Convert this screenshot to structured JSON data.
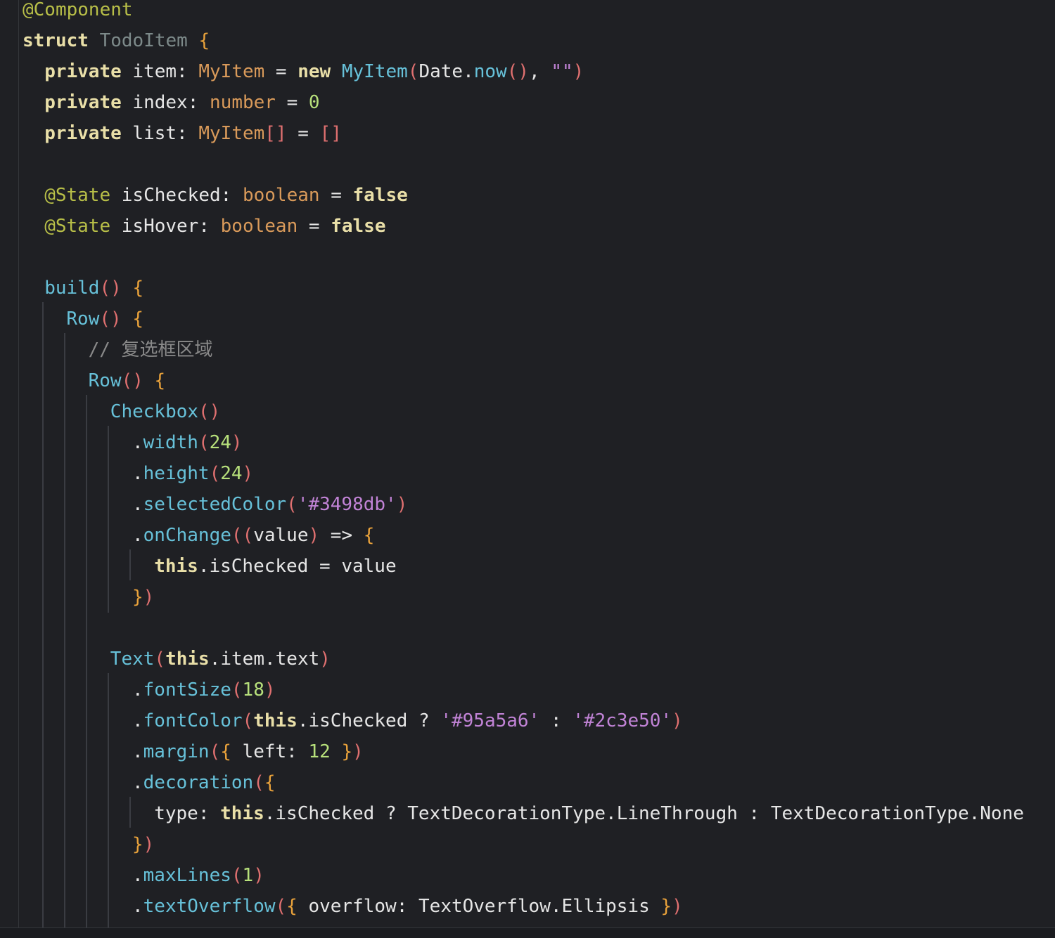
{
  "editor": {
    "lines": [
      [
        [
          "t-ann",
          "@Component"
        ]
      ],
      [
        [
          "t-kw",
          "struct"
        ],
        [
          "t-op",
          " "
        ],
        [
          "t-name",
          "TodoItem"
        ],
        [
          "t-op",
          " "
        ],
        [
          "t-brace",
          "{"
        ]
      ],
      [
        [
          "t-kw",
          "private"
        ],
        [
          "t-op",
          " "
        ],
        [
          "t-ident",
          "item"
        ],
        [
          "t-punc",
          ": "
        ],
        [
          "t-type",
          "MyItem"
        ],
        [
          "t-op",
          " = "
        ],
        [
          "t-kw",
          "new"
        ],
        [
          "t-op",
          " "
        ],
        [
          "t-fn",
          "MyItem"
        ],
        [
          "t-paren",
          "("
        ],
        [
          "t-ident",
          "Date"
        ],
        [
          "t-punc",
          "."
        ],
        [
          "t-fn",
          "now"
        ],
        [
          "t-paren",
          "()"
        ],
        [
          "t-punc",
          ", "
        ],
        [
          "t-str",
          "\"\""
        ],
        [
          "t-paren",
          ")"
        ]
      ],
      [
        [
          "t-kw",
          "private"
        ],
        [
          "t-op",
          " "
        ],
        [
          "t-ident",
          "index"
        ],
        [
          "t-punc",
          ": "
        ],
        [
          "t-type",
          "number"
        ],
        [
          "t-op",
          " = "
        ],
        [
          "t-num",
          "0"
        ]
      ],
      [
        [
          "t-kw",
          "private"
        ],
        [
          "t-op",
          " "
        ],
        [
          "t-ident",
          "list"
        ],
        [
          "t-punc",
          ": "
        ],
        [
          "t-type",
          "MyItem"
        ],
        [
          "t-paren",
          "[]"
        ],
        [
          "t-op",
          " = "
        ],
        [
          "t-paren",
          "[]"
        ]
      ],
      [],
      [
        [
          "t-ann",
          "@State"
        ],
        [
          "t-op",
          " "
        ],
        [
          "t-ident",
          "isChecked"
        ],
        [
          "t-punc",
          ": "
        ],
        [
          "t-type",
          "boolean"
        ],
        [
          "t-op",
          " = "
        ],
        [
          "t-kw",
          "false"
        ]
      ],
      [
        [
          "t-ann",
          "@State"
        ],
        [
          "t-op",
          " "
        ],
        [
          "t-ident",
          "isHover"
        ],
        [
          "t-punc",
          ": "
        ],
        [
          "t-type",
          "boolean"
        ],
        [
          "t-op",
          " = "
        ],
        [
          "t-kw",
          "false"
        ]
      ],
      [],
      [
        [
          "t-fn",
          "build"
        ],
        [
          "t-paren",
          "()"
        ],
        [
          "t-op",
          " "
        ],
        [
          "t-brace",
          "{"
        ]
      ],
      [
        [
          "t-fn",
          "Row"
        ],
        [
          "t-paren",
          "()"
        ],
        [
          "t-op",
          " "
        ],
        [
          "t-brace",
          "{"
        ]
      ],
      [
        [
          "t-cmt",
          "// 复选框区域"
        ]
      ],
      [
        [
          "t-fn",
          "Row"
        ],
        [
          "t-paren",
          "()"
        ],
        [
          "t-op",
          " "
        ],
        [
          "t-brace",
          "{"
        ]
      ],
      [
        [
          "t-fn",
          "Checkbox"
        ],
        [
          "t-paren",
          "()"
        ]
      ],
      [
        [
          "t-punc",
          "."
        ],
        [
          "t-fn",
          "width"
        ],
        [
          "t-paren",
          "("
        ],
        [
          "t-num",
          "24"
        ],
        [
          "t-paren",
          ")"
        ]
      ],
      [
        [
          "t-punc",
          "."
        ],
        [
          "t-fn",
          "height"
        ],
        [
          "t-paren",
          "("
        ],
        [
          "t-num",
          "24"
        ],
        [
          "t-paren",
          ")"
        ]
      ],
      [
        [
          "t-punc",
          "."
        ],
        [
          "t-fn",
          "selectedColor"
        ],
        [
          "t-paren",
          "("
        ],
        [
          "t-str",
          "'#3498db'"
        ],
        [
          "t-paren",
          ")"
        ]
      ],
      [
        [
          "t-punc",
          "."
        ],
        [
          "t-fn",
          "onChange"
        ],
        [
          "t-paren",
          "(("
        ],
        [
          "t-ident",
          "value"
        ],
        [
          "t-paren",
          ")"
        ],
        [
          "t-op",
          " => "
        ],
        [
          "t-brace",
          "{"
        ]
      ],
      [
        [
          "t-kw",
          "this"
        ],
        [
          "t-punc",
          "."
        ],
        [
          "t-ident",
          "isChecked"
        ],
        [
          "t-op",
          " = "
        ],
        [
          "t-ident",
          "value"
        ]
      ],
      [
        [
          "t-brace",
          "}"
        ],
        [
          "t-paren",
          ")"
        ]
      ],
      [],
      [
        [
          "t-fn",
          "Text"
        ],
        [
          "t-paren",
          "("
        ],
        [
          "t-kw",
          "this"
        ],
        [
          "t-punc",
          "."
        ],
        [
          "t-ident",
          "item"
        ],
        [
          "t-punc",
          "."
        ],
        [
          "t-ident",
          "text"
        ],
        [
          "t-paren",
          ")"
        ]
      ],
      [
        [
          "t-punc",
          "."
        ],
        [
          "t-fn",
          "fontSize"
        ],
        [
          "t-paren",
          "("
        ],
        [
          "t-num",
          "18"
        ],
        [
          "t-paren",
          ")"
        ]
      ],
      [
        [
          "t-punc",
          "."
        ],
        [
          "t-fn",
          "fontColor"
        ],
        [
          "t-paren",
          "("
        ],
        [
          "t-kw",
          "this"
        ],
        [
          "t-punc",
          "."
        ],
        [
          "t-ident",
          "isChecked"
        ],
        [
          "t-op",
          " ? "
        ],
        [
          "t-str",
          "'#95a5a6'"
        ],
        [
          "t-op",
          " : "
        ],
        [
          "t-str",
          "'#2c3e50'"
        ],
        [
          "t-paren",
          ")"
        ]
      ],
      [
        [
          "t-punc",
          "."
        ],
        [
          "t-fn",
          "margin"
        ],
        [
          "t-paren",
          "("
        ],
        [
          "t-brace",
          "{"
        ],
        [
          "t-op",
          " "
        ],
        [
          "t-ident",
          "left"
        ],
        [
          "t-punc",
          ": "
        ],
        [
          "t-num",
          "12"
        ],
        [
          "t-op",
          " "
        ],
        [
          "t-brace",
          "}"
        ],
        [
          "t-paren",
          ")"
        ]
      ],
      [
        [
          "t-punc",
          "."
        ],
        [
          "t-fn",
          "decoration"
        ],
        [
          "t-paren",
          "("
        ],
        [
          "t-brace",
          "{"
        ]
      ],
      [
        [
          "t-ident",
          "type"
        ],
        [
          "t-punc",
          ": "
        ],
        [
          "t-kw",
          "this"
        ],
        [
          "t-punc",
          "."
        ],
        [
          "t-ident",
          "isChecked"
        ],
        [
          "t-op",
          " ? "
        ],
        [
          "t-ident",
          "TextDecorationType"
        ],
        [
          "t-punc",
          "."
        ],
        [
          "t-ident",
          "LineThrough"
        ],
        [
          "t-op",
          " : "
        ],
        [
          "t-ident",
          "TextDecorationType"
        ],
        [
          "t-punc",
          "."
        ],
        [
          "t-ident",
          "None"
        ]
      ],
      [
        [
          "t-brace",
          "}"
        ],
        [
          "t-paren",
          ")"
        ]
      ],
      [
        [
          "t-punc",
          "."
        ],
        [
          "t-fn",
          "maxLines"
        ],
        [
          "t-paren",
          "("
        ],
        [
          "t-num",
          "1"
        ],
        [
          "t-paren",
          ")"
        ]
      ],
      [
        [
          "t-punc",
          "."
        ],
        [
          "t-fn",
          "textOverflow"
        ],
        [
          "t-paren",
          "("
        ],
        [
          "t-brace",
          "{"
        ],
        [
          "t-op",
          " "
        ],
        [
          "t-ident",
          "overflow"
        ],
        [
          "t-punc",
          ": "
        ],
        [
          "t-ident",
          "TextOverflow"
        ],
        [
          "t-punc",
          "."
        ],
        [
          "t-ident",
          "Ellipsis"
        ],
        [
          "t-op",
          " "
        ],
        [
          "t-brace",
          "}"
        ],
        [
          "t-paren",
          ")"
        ]
      ]
    ]
  }
}
